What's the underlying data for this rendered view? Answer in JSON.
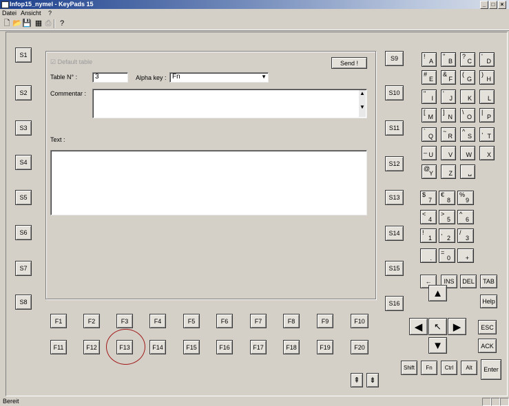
{
  "window": {
    "title": "Infop15_nymel - KeyPads 15"
  },
  "menu": [
    "Datei",
    "Ansicht",
    "?"
  ],
  "toolbar_icons": [
    "new-file-icon",
    "open-folder-icon",
    "save-icon",
    "table-icon",
    "print-icon",
    "help-icon"
  ],
  "softkeys_left": [
    "S1",
    "S2",
    "S3",
    "S4",
    "S5",
    "S6",
    "S7",
    "S8"
  ],
  "softkeys_right": [
    "S9",
    "S10",
    "S11",
    "S12",
    "S13",
    "S14",
    "S15",
    "S16"
  ],
  "form": {
    "default_table": "Default table",
    "send": "Send !",
    "table_label": "Table N° :",
    "table_value": "3",
    "alpha_label": "Alpha key :",
    "alpha_value": "Fn",
    "commentar_label": "Commentar :",
    "commentar_value": "",
    "text_label": "Text :",
    "text_value": ""
  },
  "fkeys_row1": [
    "F1",
    "F2",
    "F3",
    "F4",
    "F5",
    "F6",
    "F7",
    "F8",
    "F9",
    "F10"
  ],
  "fkeys_row2": [
    "F11",
    "F12",
    "F13",
    "F14",
    "F15",
    "F16",
    "F17",
    "F18",
    "F19",
    "F20"
  ],
  "alpha_keys": [
    [
      "A",
      "!"
    ],
    [
      "B",
      "\""
    ],
    [
      "C",
      "?"
    ],
    [
      "D",
      "'"
    ],
    [
      "E",
      "#"
    ],
    [
      "F",
      "&"
    ],
    [
      "G",
      "("
    ],
    [
      "H",
      ")"
    ],
    [
      "I",
      "\""
    ],
    [
      "J",
      "'"
    ],
    [
      "K",
      ""
    ],
    [
      "L",
      ""
    ],
    [
      "M",
      "["
    ],
    [
      "N",
      "]"
    ],
    [
      "O",
      "\\"
    ],
    [
      "P",
      "|"
    ],
    [
      "Q",
      "`"
    ],
    [
      "R",
      "~"
    ],
    [
      "S",
      "^"
    ],
    [
      "T",
      ","
    ],
    [
      "U",
      "_"
    ],
    [
      "V",
      ""
    ],
    [
      "W",
      ""
    ],
    [
      "X",
      ""
    ],
    [
      "Y",
      "@"
    ],
    [
      "Z",
      ""
    ],
    [
      "␣",
      ""
    ]
  ],
  "num_keys": [
    [
      "7",
      "$"
    ],
    [
      "8",
      "€"
    ],
    [
      "9",
      "%"
    ],
    [
      "4",
      "<"
    ],
    [
      "5",
      ">"
    ],
    [
      "6",
      "^"
    ],
    [
      "1",
      "!"
    ],
    [
      "2",
      ","
    ],
    [
      "3",
      "/"
    ],
    [
      ".",
      ""
    ],
    [
      "0",
      "="
    ],
    [
      "+",
      ""
    ]
  ],
  "edit_keys": {
    "backspace": "←",
    "ins": "INS",
    "del": "DEL",
    "tab": "TAB",
    "help": "Help",
    "esc": "ESC",
    "ack": "ACK",
    "enter": "Enter"
  },
  "modifiers": [
    "Shift",
    "Fn",
    "Ctrl",
    "Alt"
  ],
  "status": {
    "text": "Bereit"
  }
}
